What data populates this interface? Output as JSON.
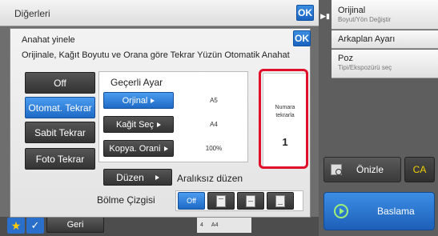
{
  "header": {
    "title": "Diğerleri",
    "ok_label": "OK"
  },
  "sidebar": {
    "items": [
      {
        "label": "Orijinal",
        "sub": "Boyut/Yön Değiştir"
      },
      {
        "label": "Arkaplan Ayarı",
        "sub": ""
      },
      {
        "label": "Poz",
        "sub": "Tipi/Ekspozürü seç"
      }
    ],
    "preview_label": "Önizle",
    "ca_label": "CA",
    "start_label": "Baslama"
  },
  "bottom": {
    "back_label": "Geri",
    "tray_left": "4",
    "tray_right": "A4"
  },
  "modal": {
    "title": "Anahat yinele",
    "description": "Orijinale, Kağıt Boyutu ve Orana göre Tekrar Yüzün Otomatik Anahat",
    "ok_label": "OK",
    "modes": [
      "Off",
      "Otomat. Tekrar",
      "Sabit Tekrar",
      "Foto Tekrar"
    ],
    "active_mode": "Otomat. Tekrar",
    "settings": {
      "heading": "Geçerli Ayar",
      "rows": [
        {
          "label": "Orjinal",
          "value": "A5"
        },
        {
          "label": "Kağit Seç",
          "value": "A4"
        },
        {
          "label": "Kopya. Orani",
          "value": "100%"
        }
      ]
    },
    "repeat": {
      "label_line1": "Numara",
      "label_line2": "tekrarla",
      "count": "1"
    },
    "layout": {
      "button_label": "Düzen",
      "value": "Aralıksız düzen"
    },
    "divider": {
      "label": "Bölme Çizgisi",
      "off_label": "Off"
    }
  }
}
